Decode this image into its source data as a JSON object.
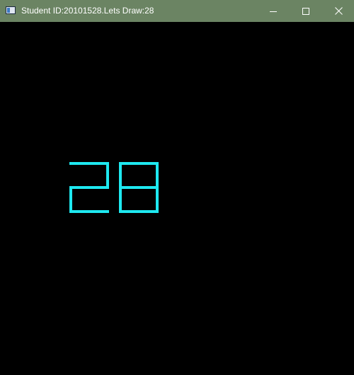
{
  "window": {
    "title": "Student ID:20101528.Lets Draw:28",
    "titlebar_color": "#6b8463",
    "title_text_color": "#ffffff",
    "icons": {
      "app": "app-window-icon",
      "minimize": "minimize-icon",
      "maximize": "maximize-icon",
      "close": "close-icon"
    }
  },
  "canvas": {
    "background_color": "#000000",
    "stroke_color": "#1ee8f0",
    "drawn_number": "28"
  }
}
